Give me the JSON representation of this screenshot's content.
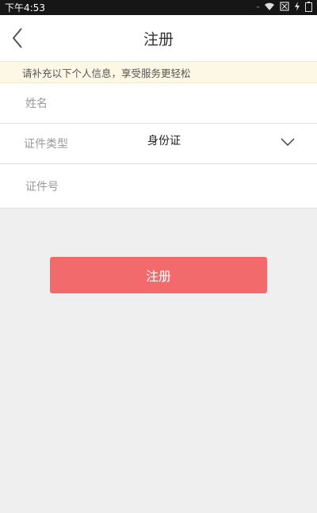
{
  "status_bar": {
    "time": "下午4:53",
    "wifi_icon": "wifi-icon",
    "sim_icon": "no-sim-icon",
    "charging_icon": "charging-icon"
  },
  "nav": {
    "back_icon": "chevron-left-icon",
    "title": "注册"
  },
  "notice": {
    "text": "请补充以下个人信息，享受服务更轻松"
  },
  "form": {
    "name": {
      "placeholder": "姓名"
    },
    "id_type": {
      "label": "证件类型",
      "value": "身份证",
      "icon": "chevron-down-icon"
    },
    "id_number": {
      "placeholder": "证件号"
    }
  },
  "submit": {
    "label": "注册",
    "color": "#f36a6c"
  }
}
